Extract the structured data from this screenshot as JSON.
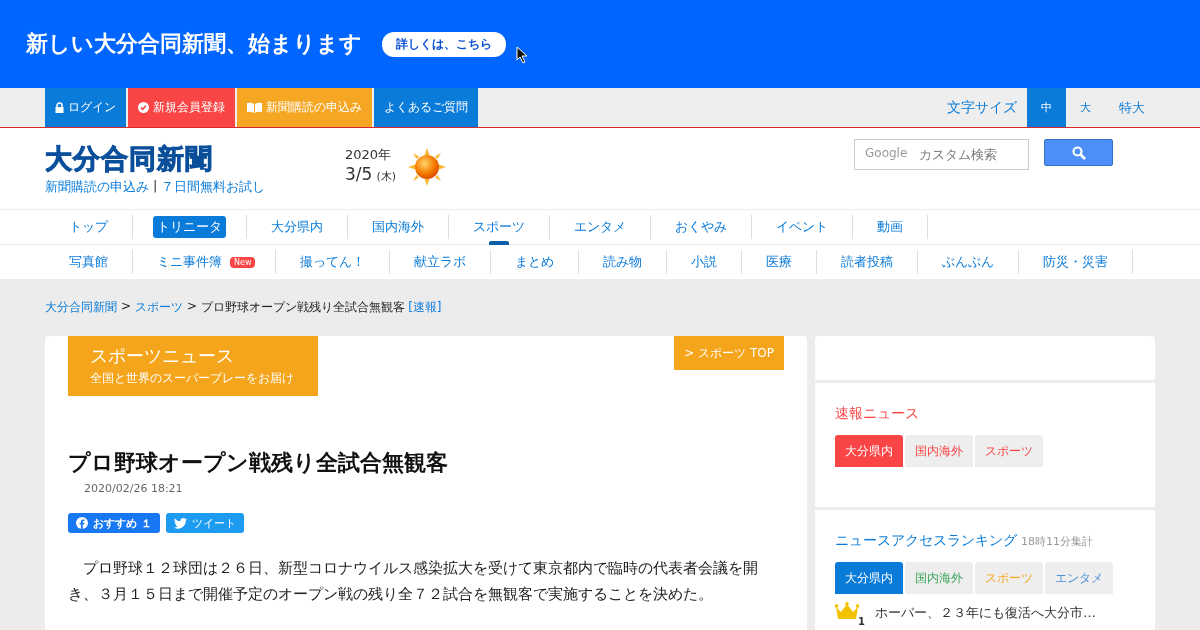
{
  "banner": {
    "headline": "新しい大分合同新聞、始まります",
    "button": "詳しくは、こちら"
  },
  "top_links": [
    {
      "label": "ログイン",
      "kind": "lock",
      "color": "#0a7bd9"
    },
    {
      "label": "新規会員登録",
      "kind": "check",
      "color": "#f94545"
    },
    {
      "label": "新聞購読の申込み",
      "kind": "book",
      "color": "#f5a623"
    },
    {
      "label": "よくあるご質問",
      "kind": "plain",
      "color": "#0a7bd9"
    }
  ],
  "font_size": {
    "label": "文字サイズ",
    "options": [
      {
        "label": "中",
        "selected": true
      },
      {
        "label": "大",
        "selected": false
      },
      {
        "label": "特大",
        "selected": false
      }
    ]
  },
  "header": {
    "logo": "大分合同新聞",
    "links": [
      "新聞購読の申込み",
      "７日間無料お試し"
    ],
    "link_separator": "|",
    "year": "2020年",
    "date": "3/5",
    "weekday": "(木)",
    "search": {
      "brand": "Google",
      "placeholder": "カスタム検索"
    }
  },
  "nav": [
    {
      "label": "トップ",
      "highlighted": false,
      "selected": false
    },
    {
      "label": "トリニータ",
      "highlighted": true,
      "selected": false
    },
    {
      "label": "大分県内",
      "highlighted": false,
      "selected": false
    },
    {
      "label": "国内海外",
      "highlighted": false,
      "selected": false
    },
    {
      "label": "スポーツ",
      "highlighted": false,
      "selected": true
    },
    {
      "label": "エンタメ",
      "highlighted": false,
      "selected": false
    },
    {
      "label": "おくやみ",
      "highlighted": false,
      "selected": false
    },
    {
      "label": "イベント",
      "highlighted": false,
      "selected": false
    },
    {
      "label": "動画",
      "highlighted": false,
      "selected": false
    }
  ],
  "subnav": [
    {
      "label": "写真館"
    },
    {
      "label": "ミニ事件簿",
      "badge": "New"
    },
    {
      "label": "撮ってん！"
    },
    {
      "label": "献立ラボ"
    },
    {
      "label": "まとめ"
    },
    {
      "label": "読み物"
    },
    {
      "label": "小説"
    },
    {
      "label": "医療"
    },
    {
      "label": "読者投稿"
    },
    {
      "label": "ぶんぶん"
    },
    {
      "label": "防災・災害"
    }
  ],
  "breadcrumb": {
    "separator": ">",
    "links": [
      "大分合同新聞",
      "スポーツ"
    ],
    "current": "プロ野球オープン戦残り全試合無観客",
    "tag": "[速報]"
  },
  "article": {
    "section_title": "スポーツニュース",
    "section_subtitle": "全国と世界のスーパープレーをお届け",
    "section_link": "> スポーツ TOP",
    "title": "プロ野球オープン戦残り全試合無観客",
    "date": "2020/02/26 18:21",
    "share": [
      {
        "kind": "facebook",
        "label": "おすすめ １"
      },
      {
        "kind": "twitter",
        "label": "ツイート"
      }
    ],
    "body": "　プロ野球１２球団は２６日、新型コロナウイルス感染拡大を受けて東京都内で臨時の代表者会議を開き、３月１５日まで開催予定のオープン戦の残り全７２試合を無観客で実施することを決めた。"
  },
  "breaking_news": {
    "title": "速報ニュース",
    "tabs": [
      {
        "label": "大分県内",
        "selected": true,
        "color": "#f94545"
      },
      {
        "label": "国内海外",
        "selected": false,
        "color": "#f94545"
      },
      {
        "label": "スポーツ",
        "selected": false,
        "color": "#f94545"
      }
    ]
  },
  "ranking": {
    "title": "ニュースアクセスランキング",
    "note": "18時11分集計",
    "tabs": [
      {
        "label": "大分県内",
        "selected": true,
        "color": "#0a7bd9"
      },
      {
        "label": "国内海外",
        "selected": false,
        "color": "#3aa55a"
      },
      {
        "label": "スポーツ",
        "selected": false,
        "color": "#f5a623"
      },
      {
        "label": "エンタメ",
        "selected": false,
        "color": "#4a90d9"
      }
    ],
    "items": [
      {
        "rank": "1",
        "title": "ホーバー、２３年にも復活へ大分市…"
      }
    ]
  }
}
